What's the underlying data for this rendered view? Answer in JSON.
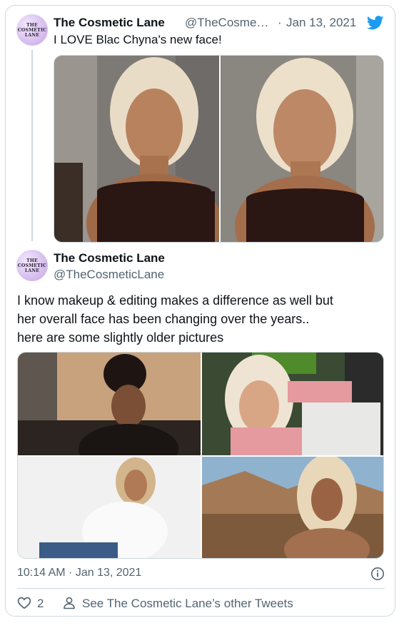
{
  "quoted_tweet": {
    "author_name": "The Cosmetic Lane",
    "author_handle": "@TheCosme…",
    "separator": "·",
    "date": "Jan 13, 2021",
    "text": "I LOVE Blac Chyna's new face!",
    "avatar_text": [
      "THE",
      "COSMETIC",
      "LANE"
    ]
  },
  "main_tweet": {
    "author_name": "The Cosmetic Lane",
    "author_handle": "@TheCosmeticLane",
    "avatar_text": [
      "THE",
      "COSMETIC",
      "LANE"
    ],
    "text_lines": [
      "I know makeup & editing makes a difference as well but",
      "her overall face has been changing over the years..",
      "here are some slightly older pictures"
    ]
  },
  "footer": {
    "timestamp": "10:14 AM · Jan 13, 2021",
    "like_count": "2",
    "see_other_tweets": "See The Cosmetic Lane’s other Tweets"
  },
  "icons": {
    "brand": "twitter-bird-icon",
    "info": "info-icon",
    "like": "heart-icon",
    "profile": "person-icon"
  },
  "colors": {
    "twitter_blue": "#1d9bf0",
    "secondary_text": "#536471",
    "border": "#cfd9de"
  }
}
